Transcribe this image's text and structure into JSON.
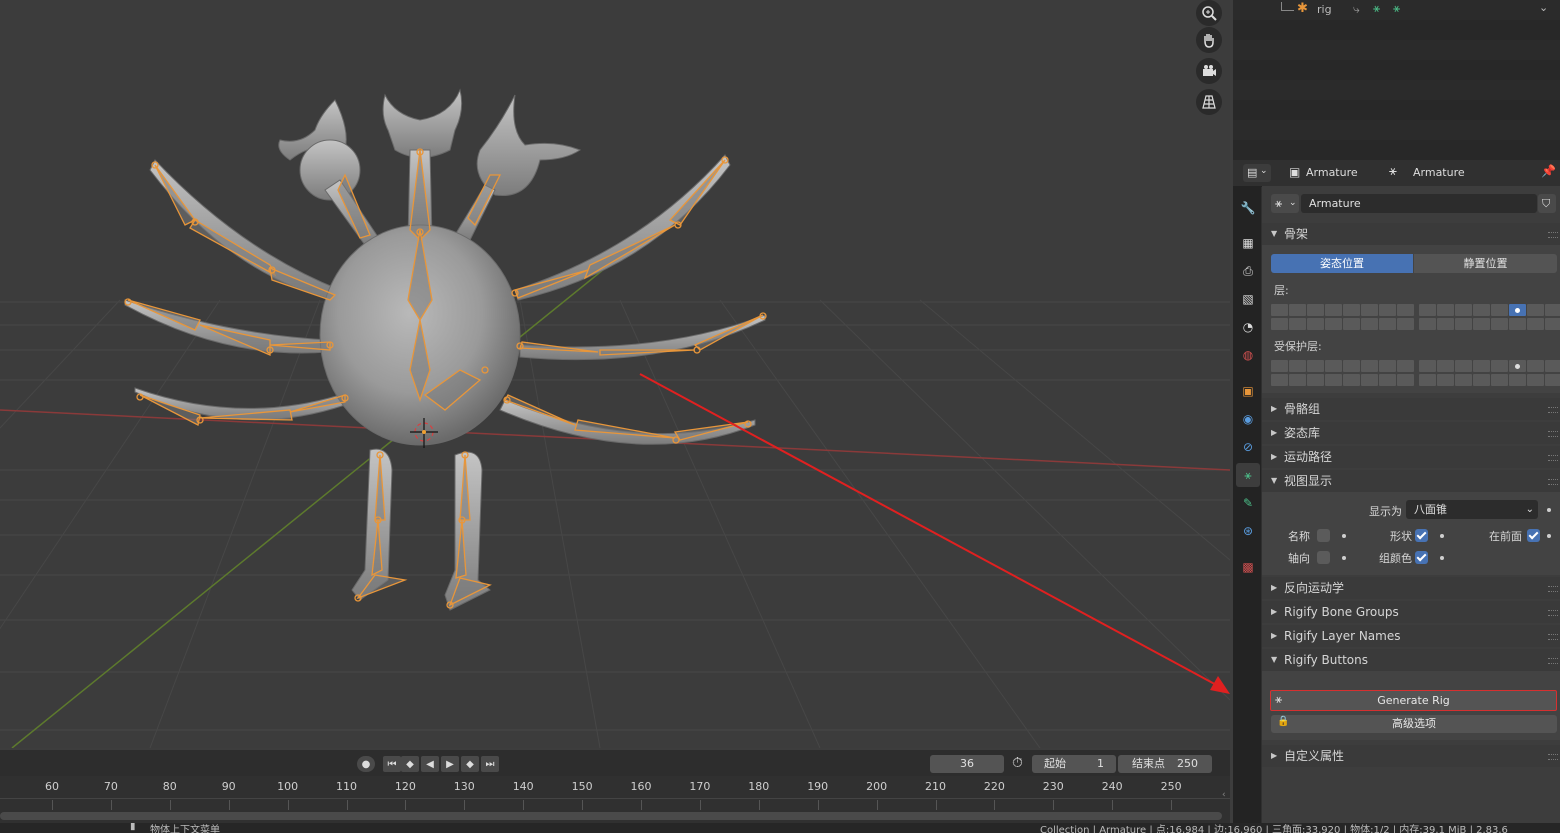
{
  "outliner": {
    "rig_label": "rig"
  },
  "properties": {
    "breadcrumb": [
      "Armature",
      "Armature"
    ],
    "datablock_name": "Armature",
    "panels": {
      "skeleton": "骨架",
      "pose_position": "姿态位置",
      "rest_position": "静置位置",
      "layers": "层:",
      "protected_layers": "受保护层:",
      "bone_groups": "骨骼组",
      "pose_library": "姿态库",
      "motion_paths": "运动路径",
      "viewport_display": "视图显示",
      "display_as_label": "显示为",
      "display_as_value": "八面锥",
      "names": "名称",
      "shapes": "形状",
      "in_front": "在前面",
      "axes": "轴向",
      "group_colors": "组颜色",
      "inverse_kinematics": "反向运动学",
      "rigify_bone_groups": "Rigify Bone Groups",
      "rigify_layer_names": "Rigify Layer Names",
      "rigify_buttons": "Rigify Buttons",
      "generate_rig": "Generate Rig",
      "advanced_options": "高级选项",
      "custom_properties": "自定义属性"
    },
    "checkboxes": {
      "names": false,
      "shapes": true,
      "in_front": true,
      "axes": false,
      "group_colors": true
    }
  },
  "timeline": {
    "current_frame": "36",
    "start_label": "起始",
    "start_value": "1",
    "end_label": "结束点",
    "end_value": "250",
    "ruler_ticks": [
      "60",
      "70",
      "80",
      "90",
      "100",
      "110",
      "120",
      "130",
      "140",
      "150",
      "160",
      "170",
      "180",
      "190",
      "200",
      "210",
      "220",
      "230",
      "240",
      "250"
    ]
  },
  "statusbar": {
    "left_text": "物体上下文菜单",
    "right_text": "Collection | Armature | 点:16,984 | 边:16,960 | 三角面:33,920 | 物体:1/2 | 内存:39.1 MiB | 2.83.6"
  },
  "colors": {
    "accent_blue": "#4772b3",
    "armature_orange": "#e8963a",
    "annotation_red": "#e02020",
    "highlight_border": "#d63030"
  }
}
